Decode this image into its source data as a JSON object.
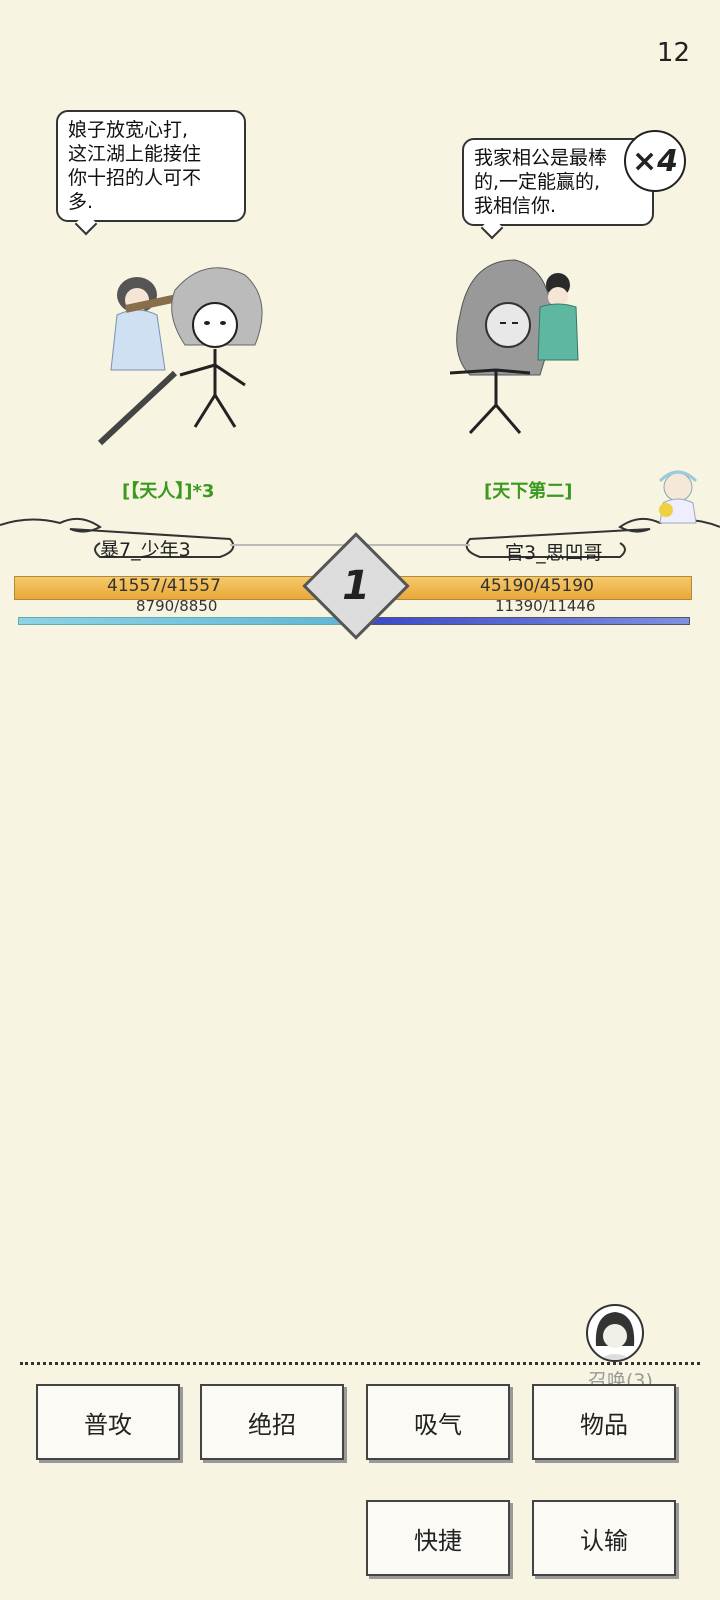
{
  "timer": "12",
  "left": {
    "speech": "娘子放宽心打,这江湖上能接住你十招的人可不多.",
    "speech_lines": [
      "娘子放宽心打,",
      "这江湖上能接住",
      "你十招的人可不",
      "多."
    ],
    "title": "[【天人】]*3",
    "player_name": "暴7_少年3",
    "hp_text": "41557/41557",
    "hp_fraction": 1.0,
    "mp_text": "8790/8850",
    "mp_fraction": 0.993
  },
  "right": {
    "speech_lines": [
      "我家相公是最棒",
      "的,一定能赢的,",
      "我相信你."
    ],
    "title": "[天下第二]",
    "player_name": "官3_思凹哥",
    "hp_text": "45190/45190",
    "hp_fraction": 1.0,
    "mp_text": "11390/11446",
    "mp_fraction": 0.995
  },
  "speed_badge": "×4",
  "round": "1",
  "summon_label": "召唤(3)",
  "buttons": {
    "attack": "普攻",
    "ultimate": "绝招",
    "absorb": "吸气",
    "items": "物品",
    "shortcut": "快捷",
    "surrender": "认输"
  },
  "colors": {
    "background": "#f8f4e2",
    "hp_bar": "#e9a838",
    "mp_left": "#5fb5d6",
    "mp_right": "#3848c8",
    "title_green": "#3a9a1e"
  },
  "icons": {
    "summon_avatar": "summon-avatar-icon",
    "speed": "speed-x4-icon",
    "round": "round-diamond-icon"
  }
}
